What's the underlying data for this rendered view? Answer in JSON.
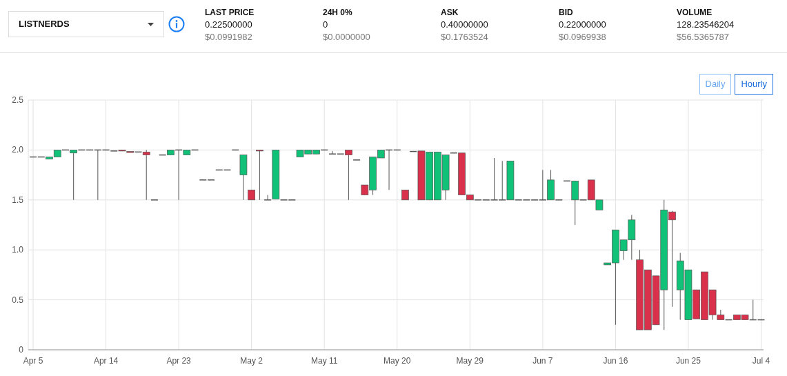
{
  "market_select": {
    "value": "LISTNERDS"
  },
  "stats": [
    {
      "label": "LAST PRICE",
      "value": "0.22500000",
      "usd": "$0.0991982"
    },
    {
      "label": "24H 0%",
      "value": "0",
      "usd": "$0.0000000"
    },
    {
      "label": "ASK",
      "value": "0.40000000",
      "usd": "$0.1763524"
    },
    {
      "label": "BID",
      "value": "0.22000000",
      "usd": "$0.0969938"
    },
    {
      "label": "VOLUME",
      "value": "128.23546204",
      "usd": "$56.5365787"
    }
  ],
  "interval_tabs": [
    {
      "label": "Daily",
      "selected": false
    },
    {
      "label": "Hourly",
      "selected": true
    }
  ],
  "chart": {
    "chart_data": {
      "type": "candlestick",
      "categories": [
        "Apr 5",
        null,
        null,
        null,
        null,
        null,
        null,
        null,
        null,
        "Apr 14",
        null,
        null,
        null,
        null,
        null,
        null,
        null,
        null,
        "Apr 23",
        null,
        null,
        null,
        null,
        null,
        null,
        null,
        null,
        "May 2",
        null,
        null,
        null,
        null,
        null,
        null,
        null,
        null,
        "May 11",
        null,
        null,
        null,
        null,
        null,
        null,
        null,
        null,
        "May 20",
        null,
        null,
        null,
        null,
        null,
        null,
        null,
        null,
        "May 29",
        null,
        null,
        null,
        null,
        null,
        null,
        null,
        null,
        "Jun 7",
        null,
        null,
        null,
        null,
        null,
        null,
        null,
        null,
        "Jun 16",
        null,
        null,
        null,
        null,
        null,
        null,
        null,
        null,
        "Jun 25",
        null,
        null,
        null,
        null,
        null,
        null,
        null,
        null,
        "Jul 4"
      ],
      "ohlc": [
        [
          1.93,
          1.93,
          1.93,
          1.93
        ],
        [
          1.93,
          1.93,
          1.93,
          1.93
        ],
        [
          1.91,
          1.93,
          1.91,
          1.93
        ],
        [
          1.93,
          2.0,
          1.93,
          2.0
        ],
        [
          2.0,
          2.0,
          2.0,
          2.0
        ],
        [
          1.97,
          2.0,
          1.5,
          2.0
        ],
        [
          2.0,
          2.0,
          2.0,
          2.0
        ],
        [
          2.0,
          2.0,
          2.0,
          2.0
        ],
        [
          2.0,
          2.0,
          1.5,
          2.0
        ],
        [
          2.0,
          2.0,
          2.0,
          2.0
        ],
        [
          1.99,
          1.99,
          1.99,
          1.99
        ],
        [
          2.0,
          2.0,
          1.99,
          1.99
        ],
        [
          1.985,
          1.985,
          1.98,
          1.98
        ],
        [
          1.98,
          1.98,
          1.98,
          1.98
        ],
        [
          1.98,
          2.0,
          1.5,
          1.95
        ],
        [
          1.5,
          1.5,
          1.5,
          1.5
        ],
        [
          1.95,
          1.95,
          1.95,
          1.95
        ],
        [
          1.95,
          2.0,
          1.95,
          2.0
        ],
        [
          2.0,
          2.0,
          1.5,
          2.0
        ],
        [
          1.95,
          2.0,
          1.95,
          2.0
        ],
        [
          2.0,
          2.0,
          2.0,
          2.0
        ],
        [
          1.7,
          1.7,
          1.7,
          1.7
        ],
        [
          1.7,
          1.7,
          1.7,
          1.7
        ],
        [
          1.8,
          1.8,
          1.8,
          1.8
        ],
        [
          1.8,
          1.8,
          1.8,
          1.8
        ],
        [
          2.0,
          2.0,
          2.0,
          2.0
        ],
        [
          1.75,
          1.95,
          1.5,
          1.95
        ],
        [
          1.6,
          1.6,
          1.5,
          1.5
        ],
        [
          2.0,
          2.0,
          1.5,
          1.99
        ],
        [
          1.5,
          1.55,
          1.5,
          1.5
        ],
        [
          1.51,
          2.0,
          1.51,
          2.0
        ],
        [
          1.5,
          1.5,
          1.5,
          1.5
        ],
        [
          1.5,
          1.5,
          1.5,
          1.5
        ],
        [
          1.93,
          2.0,
          1.93,
          2.0
        ],
        [
          1.96,
          2.0,
          1.96,
          2.0
        ],
        [
          1.96,
          2.0,
          1.96,
          2.0
        ],
        [
          2.0,
          2.0,
          2.0,
          2.0
        ],
        [
          1.96,
          1.99,
          1.96,
          1.96
        ],
        [
          1.96,
          1.96,
          1.96,
          1.96
        ],
        [
          2.0,
          2.0,
          1.5,
          1.95
        ],
        [
          1.9,
          1.9,
          1.9,
          1.9
        ],
        [
          1.65,
          1.65,
          1.55,
          1.55
        ],
        [
          1.6,
          1.93,
          1.55,
          1.93
        ],
        [
          1.92,
          2.0,
          1.92,
          2.0
        ],
        [
          2.0,
          2.0,
          1.6,
          2.0
        ],
        [
          2.0,
          2.0,
          2.0,
          2.0
        ],
        [
          1.6,
          1.6,
          1.5,
          1.5
        ],
        [
          1.985,
          1.985,
          1.985,
          1.985
        ],
        [
          1.99,
          1.99,
          1.5,
          1.5
        ],
        [
          1.5,
          1.98,
          1.5,
          1.98
        ],
        [
          1.5,
          1.98,
          1.5,
          1.98
        ],
        [
          1.6,
          1.95,
          1.5,
          1.95
        ],
        [
          1.97,
          1.97,
          1.97,
          1.97
        ],
        [
          1.97,
          1.97,
          1.55,
          1.55
        ],
        [
          1.55,
          1.55,
          1.5,
          1.5
        ],
        [
          1.5,
          1.5,
          1.5,
          1.5
        ],
        [
          1.5,
          1.5,
          1.5,
          1.5
        ],
        [
          1.5,
          1.92,
          1.5,
          1.5
        ],
        [
          1.5,
          1.89,
          1.5,
          1.5
        ],
        [
          1.5,
          1.89,
          1.5,
          1.89
        ],
        [
          1.5,
          1.5,
          1.5,
          1.5
        ],
        [
          1.5,
          1.5,
          1.5,
          1.5
        ],
        [
          1.5,
          1.5,
          1.5,
          1.5
        ],
        [
          1.5,
          1.8,
          1.5,
          1.5
        ],
        [
          1.5,
          1.8,
          1.5,
          1.7
        ],
        [
          1.5,
          1.5,
          1.5,
          1.5
        ],
        [
          1.69,
          1.69,
          1.69,
          1.69
        ],
        [
          1.5,
          1.69,
          1.25,
          1.69
        ],
        [
          1.5,
          1.5,
          1.5,
          1.5
        ],
        [
          1.7,
          1.7,
          1.5,
          1.5
        ],
        [
          1.4,
          1.5,
          1.4,
          1.5
        ],
        [
          0.85,
          0.87,
          0.85,
          0.87
        ],
        [
          0.87,
          1.2,
          0.25,
          1.2
        ],
        [
          0.99,
          1.1,
          0.9,
          1.1
        ],
        [
          1.1,
          1.35,
          0.9,
          1.3
        ],
        [
          0.9,
          1.0,
          0.2,
          0.2
        ],
        [
          0.8,
          0.8,
          0.2,
          0.2
        ],
        [
          0.74,
          0.74,
          0.25,
          0.25
        ],
        [
          0.6,
          1.5,
          0.2,
          1.4
        ],
        [
          1.38,
          1.39,
          0.43,
          1.3
        ],
        [
          0.6,
          0.97,
          0.3,
          0.89
        ],
        [
          0.3,
          0.8,
          0.3,
          0.8
        ],
        [
          0.6,
          0.6,
          0.31,
          0.31
        ],
        [
          0.78,
          0.78,
          0.3,
          0.3
        ],
        [
          0.6,
          0.6,
          0.3,
          0.35
        ],
        [
          0.35,
          0.4,
          0.3,
          0.3
        ],
        [
          0.3,
          0.3,
          0.3,
          0.3
        ],
        [
          0.35,
          0.35,
          0.3,
          0.3
        ],
        [
          0.35,
          0.35,
          0.3,
          0.3
        ],
        [
          0.3,
          0.5,
          0.3,
          0.3
        ],
        [
          0.3,
          0.3,
          0.3,
          0.3
        ]
      ],
      "ylim": [
        0,
        2.5
      ],
      "grid": true,
      "yticks": [
        {
          "value": 0,
          "label": "0"
        },
        {
          "value": 0.5,
          "label": "0.5"
        },
        {
          "value": 1,
          "label": "1.0"
        },
        {
          "value": 1.5,
          "label": "1.5"
        },
        {
          "value": 2,
          "label": "2.0"
        },
        {
          "value": 2.5,
          "label": "2.5"
        }
      ]
    }
  }
}
